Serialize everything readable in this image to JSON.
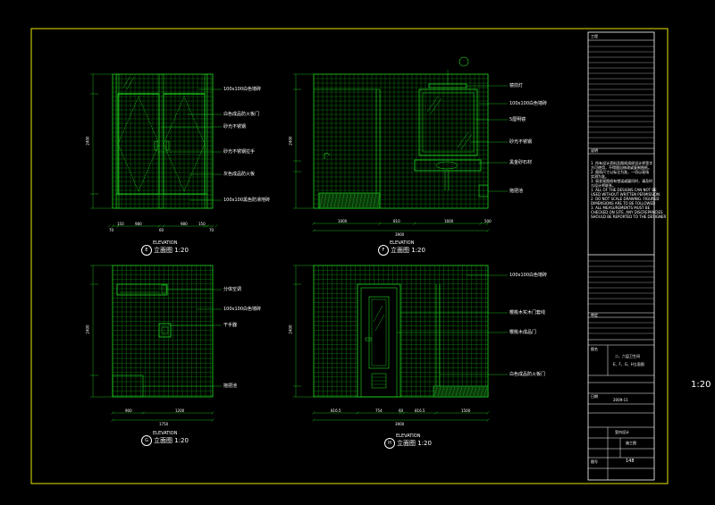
{
  "elevations": [
    {
      "id": "E",
      "title": "立面图 1:20",
      "elevation_word": "ELEVATION",
      "badge": "E",
      "annotations": [
        "100x100白色墙砖",
        "白色成品防火板门",
        "砂光不锈钢",
        "砂光不锈钢拉手",
        "灰色成品防火板",
        "100x100黑色防滑地砖"
      ],
      "dims_bottom": [
        "70",
        "150",
        "980",
        "60",
        "980",
        "150",
        "70"
      ],
      "dim_total": "",
      "dim_left": "2400"
    },
    {
      "id": "F",
      "title": "立面图 1:20",
      "elevation_word": "ELEVATION",
      "badge": "F",
      "annotations": [
        "镜前灯",
        "100x100白色墙砖",
        "5厘明镜",
        "砂光不锈钢",
        "黑金砂石材",
        "拖把池"
      ],
      "dims_bottom": [
        "1000",
        "810",
        "1600",
        "500"
      ],
      "dim_total": "3900",
      "dim_left": "2400"
    },
    {
      "id": "G",
      "title": "立面图 1:20",
      "elevation_word": "ELEVATION",
      "badge": "G",
      "annotations": [
        "分体空调",
        "100x100白色墙砖",
        "干手器",
        "拖把池"
      ],
      "dims_bottom": [
        "900",
        "1200"
      ],
      "dim_total": "1750",
      "dim_left": "2400"
    },
    {
      "id": "H",
      "title": "立面图 1:20",
      "elevation_word": "ELEVATION",
      "badge": "H",
      "annotations": [
        "100x100白色墙砖",
        "樱桃木实木门套线",
        "樱桃木成品门",
        "白色成品防火板门"
      ],
      "dims_bottom": [
        "816.5",
        "754",
        "60",
        "816.5",
        "1500"
      ],
      "dim_total": "3900",
      "dim_left": "2400"
    }
  ],
  "title_block": {
    "project_label": "工程",
    "notes_label": "说明",
    "notes": [
      "1. 所有设计资料及图纸须经设计师签字",
      "方可使用，不得擅自修改或复制图纸。",
      "2. 图纸尺寸以标注为准，一切以现场",
      "实测为准。",
      "3. 如发现图纸有错误或疑问时，请及时",
      "与设计师联系。",
      "1. ALL OF THE DESIGNS CAN NOT BE",
      "USED WITHOUT WRITTEN PERMISSION",
      "2. DO NOT SCALE DRAWING. FIGURED",
      "DIMENSIONS ARE TO BE FOLLOWED",
      "3. ALL MEASUREMENTS MUST BE",
      "CHECKED ON SITE. ANY DISCREPANCIES",
      "SHOULD BE REPORTED TO THE DESIGNER"
    ],
    "approval_label": "审定",
    "drawing_name_label": "图名",
    "drawing_name_1": "二、六层卫生间",
    "drawing_name_2": "E、F、G、H立面图",
    "date_label": "日期",
    "date": "2009-11",
    "design_label": "室内设计",
    "stage": "施工图",
    "sheet_label": "图号",
    "sheet_no": "148"
  },
  "scale_right": "1:20",
  "colors": {
    "frame": "#e6e600",
    "lines": "#1fdc1f",
    "tile": "#0f8a0f",
    "text": "#ffffff"
  }
}
